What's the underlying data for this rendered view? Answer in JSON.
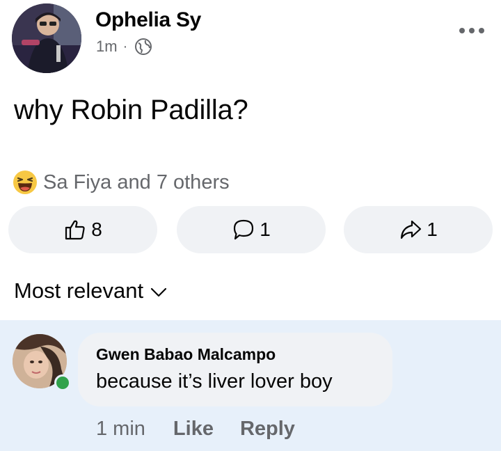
{
  "post": {
    "author": "Ophelia Sy",
    "time": "1m",
    "separator": "·",
    "audience_icon": "globe-icon",
    "text": "why Robin Padilla?"
  },
  "reactions": {
    "icon": "haha-icon",
    "summary": "Sa Fiya and 7 others"
  },
  "actions": {
    "like_count": "8",
    "comment_count": "1",
    "share_count": "1"
  },
  "sort": {
    "label": "Most relevant"
  },
  "comment": {
    "author": "Gwen Babao Malcampo",
    "text": "because it’s liver lover boy",
    "time": "1 min",
    "like_label": "Like",
    "reply_label": "Reply",
    "online": true
  },
  "colors": {
    "secondary_text": "#65676b",
    "button_bg": "#f0f2f5",
    "comment_highlight_bg": "#e7f0fa",
    "online_green": "#31a24c",
    "haha_yellow": "#f7c844"
  }
}
